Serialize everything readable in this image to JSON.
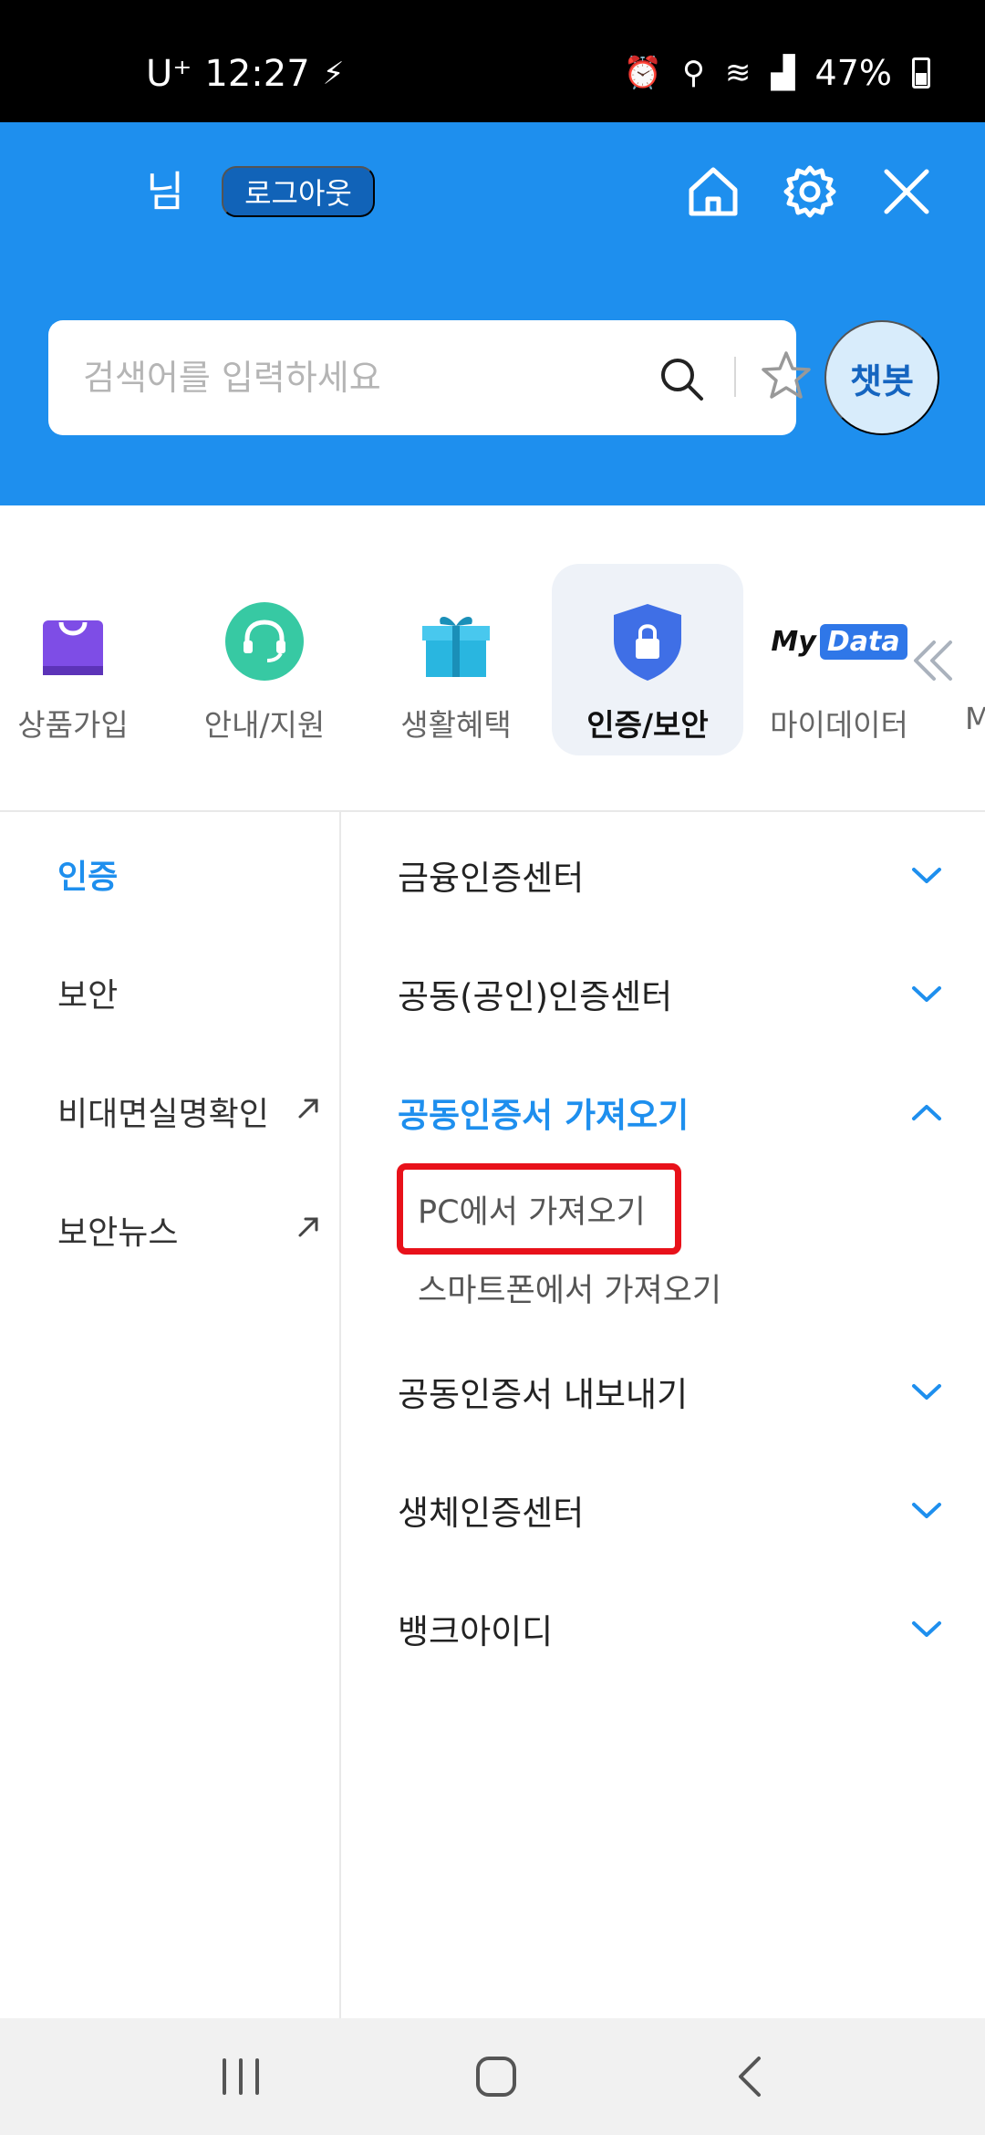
{
  "status_bar": {
    "carrier": "U⁺",
    "time": "12:27",
    "battery": "47%",
    "icons": [
      "alarm-icon",
      "location-icon",
      "wifi-icon",
      "signal-icon",
      "battery-icon"
    ]
  },
  "header": {
    "user_name": "님",
    "logout_label": "로그아웃",
    "icons": [
      "home-icon",
      "gear-icon",
      "close-icon"
    ],
    "search": {
      "placeholder": "검색어를 입력하세요",
      "value": ""
    },
    "chatbot_label": "챗봇",
    "bg_color": "#1e8fee"
  },
  "categories": {
    "items": [
      {
        "label": "상품가입",
        "icon": "shopping-bag-icon"
      },
      {
        "label": "안내/지원",
        "icon": "headset-icon"
      },
      {
        "label": "생활혜택",
        "icon": "gift-icon"
      },
      {
        "label": "인증/보안",
        "icon": "shield-lock-icon",
        "active": true
      },
      {
        "label": "마이데이터",
        "icon": "mydata-logo"
      }
    ],
    "mydata_logo": {
      "my": "My",
      "data": "Data"
    },
    "cut_label": "M"
  },
  "left_menu": {
    "items": [
      {
        "label": "인증",
        "active": true
      },
      {
        "label": "보안"
      },
      {
        "label": "비대면실명확인",
        "external": true
      },
      {
        "label": "보안뉴스",
        "external": true
      }
    ]
  },
  "right_menu": {
    "items": [
      {
        "label": "금융인증센터",
        "expanded": false
      },
      {
        "label": "공동(공인)인증센터",
        "expanded": false
      },
      {
        "label": "공동인증서 가져오기",
        "expanded": true,
        "sub_items": [
          "PC에서 가져오기",
          "스마트폰에서 가져오기"
        ]
      },
      {
        "label": "공동인증서 내보내기",
        "expanded": false
      },
      {
        "label": "생체인증센터",
        "expanded": false
      },
      {
        "label": "뱅크아이디",
        "expanded": false
      }
    ],
    "highlight_color": "#e8111a"
  },
  "nav_bar": {
    "buttons": [
      "recent-apps-icon",
      "home-nav-icon",
      "back-icon"
    ]
  }
}
